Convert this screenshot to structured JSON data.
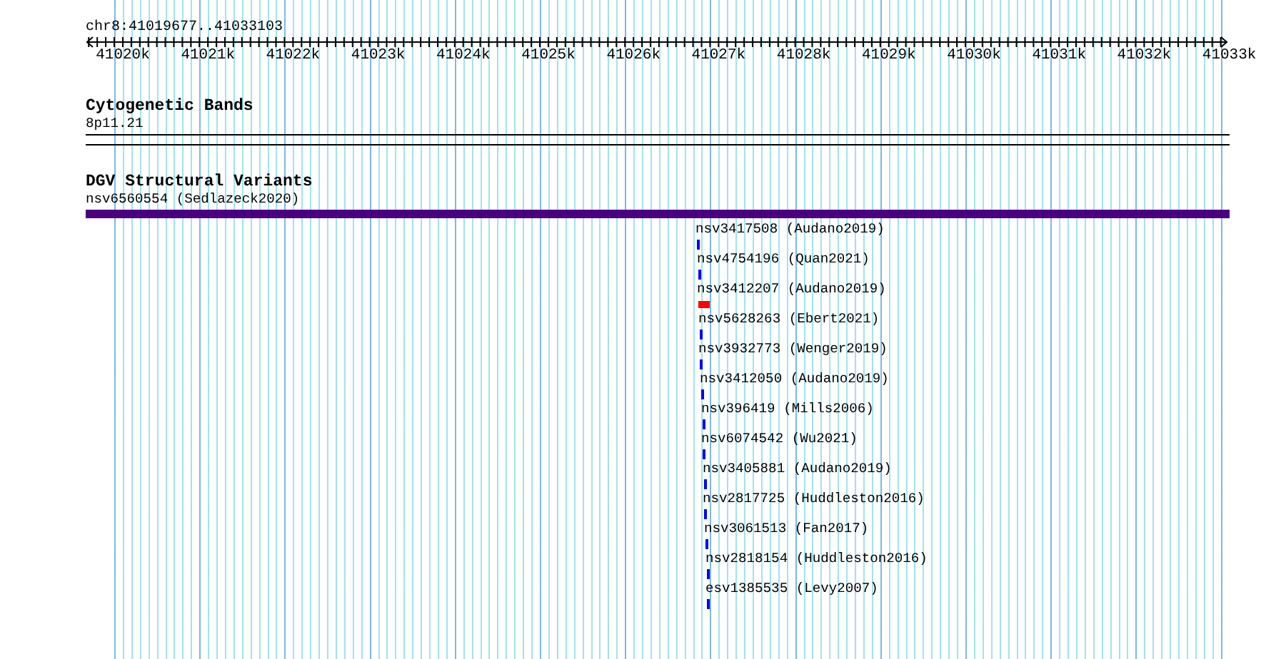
{
  "location": "chr8:41019677..41033103",
  "ruler": {
    "ticks": [
      "41020k",
      "41021k",
      "41022k",
      "41023k",
      "41024k",
      "41025k",
      "41026k",
      "41027k",
      "41028k",
      "41029k",
      "41030k",
      "41031k",
      "41032k",
      "41033k"
    ]
  },
  "tracks": [
    {
      "kind": "bands",
      "title": "Cytogenetic Bands",
      "features": [
        {
          "label": "8p11.21"
        }
      ]
    },
    {
      "kind": "variants",
      "title": "DGV Structural Variants",
      "features": [
        {
          "label": "nsv6560554 (Sedlazeck2020)",
          "kind": "span",
          "color": "#4b0082"
        },
        {
          "label": "nsv3417508 (Audano2019)",
          "kind": "tick",
          "color": "#0000ff"
        },
        {
          "label": "nsv4754196 (Quan2021)",
          "kind": "tick",
          "color": "#0000ff"
        },
        {
          "label": "nsv3412207 (Audano2019)",
          "kind": "block",
          "color": "#ff0000"
        },
        {
          "label": "nsv5628263 (Ebert2021)",
          "kind": "tick",
          "color": "#0000ff"
        },
        {
          "label": "nsv3932773 (Wenger2019)",
          "kind": "tick",
          "color": "#0000ff"
        },
        {
          "label": "nsv3412050 (Audano2019)",
          "kind": "tick",
          "color": "#0000ff"
        },
        {
          "label": "nsv396419 (Mills2006)",
          "kind": "tick",
          "color": "#0000ff"
        },
        {
          "label": "nsv6074542 (Wu2021)",
          "kind": "tick",
          "color": "#0000ff"
        },
        {
          "label": "nsv3405881 (Audano2019)",
          "kind": "tick",
          "color": "#0000ff"
        },
        {
          "label": "nsv2817725 (Huddleston2016)",
          "kind": "tick",
          "color": "#0000ff"
        },
        {
          "label": "nsv3061513 (Fan2017)",
          "kind": "tick",
          "color": "#0000ff"
        },
        {
          "label": "nsv2818154 (Huddleston2016)",
          "kind": "tick",
          "color": "#0000ff"
        },
        {
          "label": "esv1385535 (Levy2007)",
          "kind": "tick",
          "color": "#0000ff"
        }
      ]
    }
  ]
}
